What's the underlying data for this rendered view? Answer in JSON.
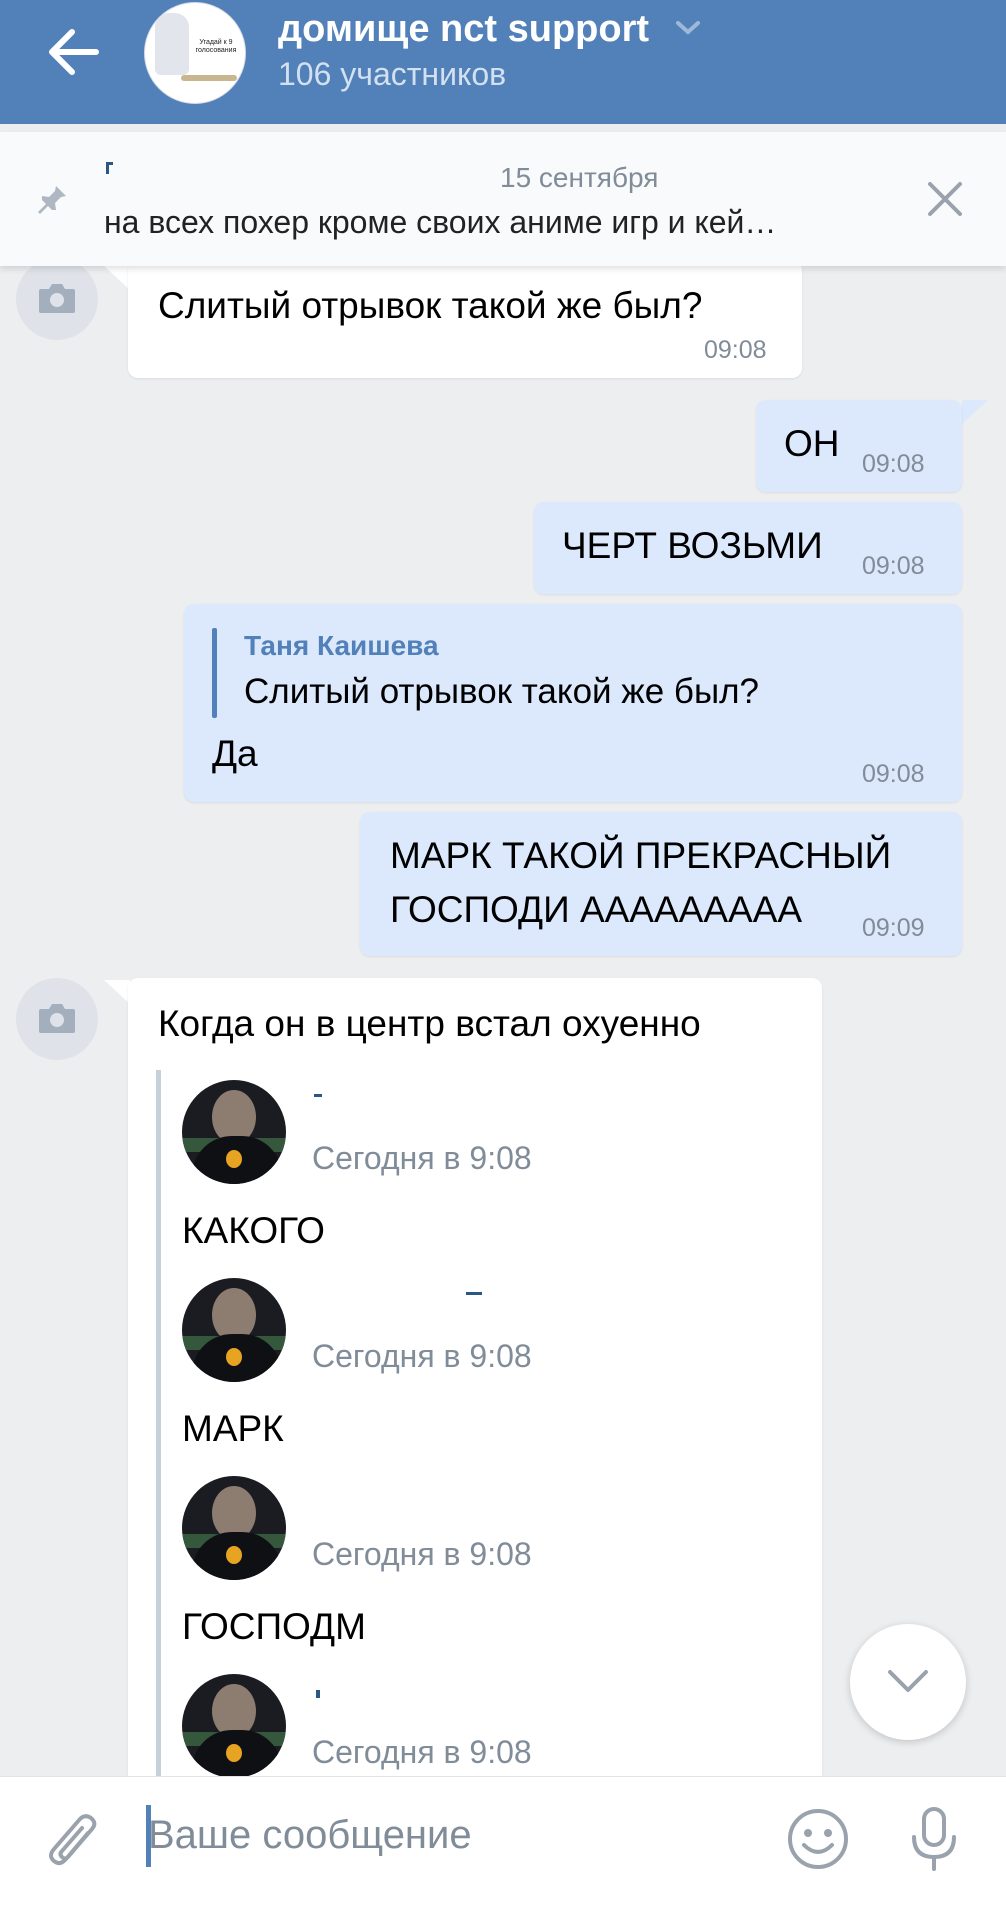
{
  "header": {
    "back_label": "Назад",
    "title": "домище nct support",
    "subtitle": "106 участников",
    "avatar_text": "Угадай к 9 голосования"
  },
  "pinned": {
    "date": "15 сентября",
    "text": "на всех похер кроме своих аниме игр и кей…"
  },
  "messages": [
    {
      "type": "in",
      "text": "Слитый отрывок такой же был?",
      "time": "09:08"
    },
    {
      "type": "out",
      "text": "ОН",
      "time": "09:08"
    },
    {
      "type": "out",
      "text": "ЧЕРТ ВОЗЬМИ",
      "time": "09:08"
    },
    {
      "type": "out",
      "reply_name": "Таня Каишева",
      "reply_text": "Слитый отрывок такой же был?",
      "text": "Да",
      "time": "09:08"
    },
    {
      "type": "out",
      "text_line1": "МАРК ТАКОЙ ПРЕКРАСНЫЙ",
      "text_line2": "ГОСПОДИ ААААААААА",
      "time": "09:09"
    },
    {
      "type": "in",
      "text": "Когда он в центр встал охуенно",
      "forwarded": [
        {
          "time": "Сегодня в 9:08",
          "text": "КАКОГО"
        },
        {
          "time": "Сегодня в 9:08",
          "text": "МАРК"
        },
        {
          "time": "Сегодня в 9:08",
          "text": "ГОСПОДМ"
        },
        {
          "time": "Сегодня в 9:08",
          "text": ""
        }
      ]
    }
  ],
  "composer": {
    "placeholder": "Ваше сообщение"
  },
  "colors": {
    "header_bg": "#5181b8",
    "outgoing_bubble": "#dce9fc",
    "incoming_bubble": "#ffffff",
    "chat_bg": "#edeef0",
    "accent": "#5181b8"
  },
  "icons": [
    "back-arrow-icon",
    "chevron-down-icon",
    "pin-icon",
    "close-icon",
    "camera-icon",
    "scroll-down-icon",
    "paperclip-icon",
    "emoji-icon",
    "microphone-icon"
  ]
}
